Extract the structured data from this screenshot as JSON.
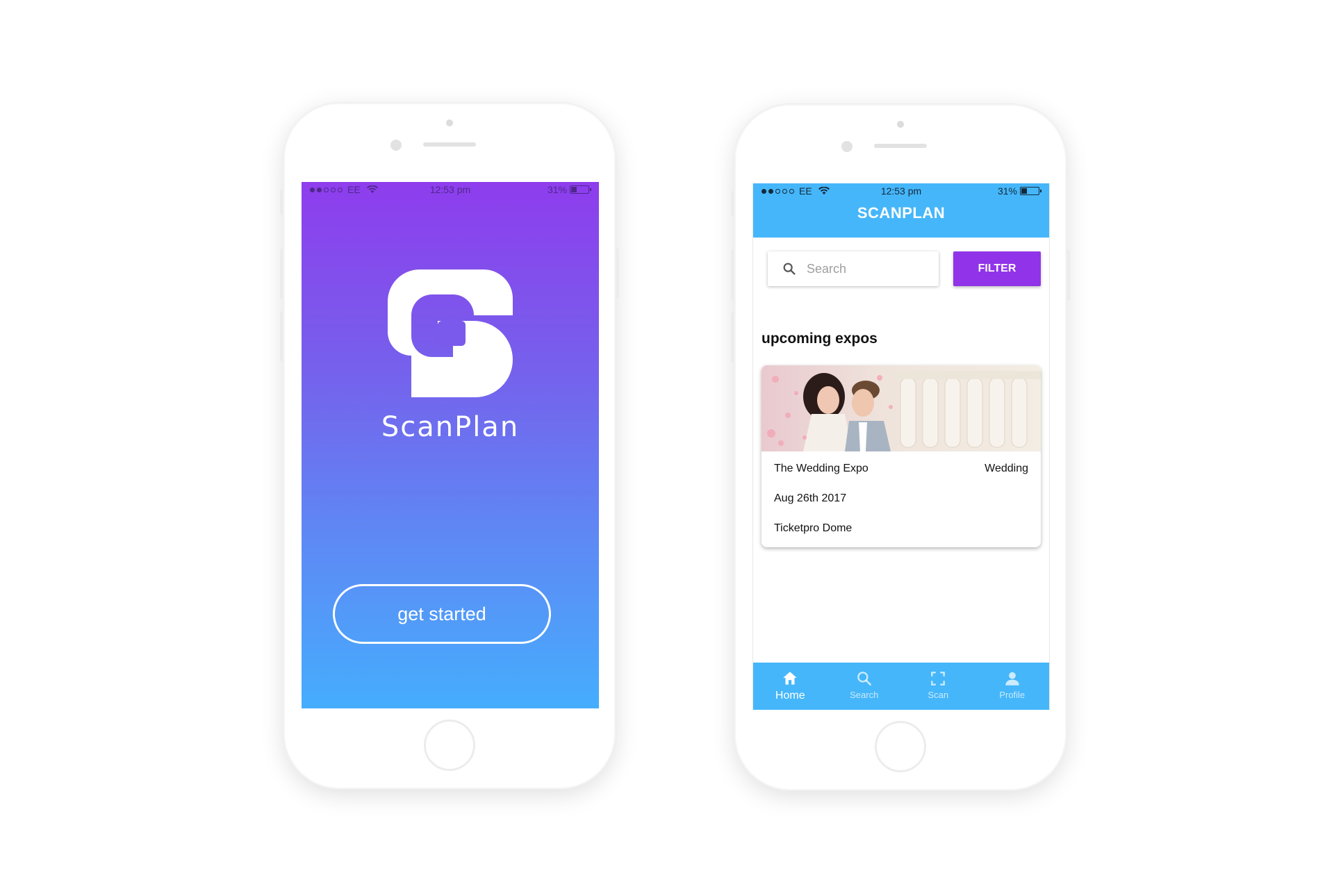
{
  "status_bar": {
    "carrier": "EE",
    "time": "12:53 pm",
    "battery": "31%",
    "signal_bars": 5,
    "signal_filled": 2
  },
  "splash": {
    "app_name": "ScanPlan",
    "cta_label": "get started",
    "logo_icon": "scanplan-logo",
    "gradient": [
      "#8e3ded",
      "#45adfd"
    ]
  },
  "home": {
    "app_bar_title": "SCANPLAN",
    "search": {
      "placeholder": "Search",
      "value": ""
    },
    "filter_label": "FILTER",
    "section_title": "upcoming expos",
    "expos": [
      {
        "title": "The Wedding Expo",
        "category": "Wedding",
        "date": "Aug 26th 2017",
        "venue": "Ticketpro Dome"
      }
    ],
    "bottom_nav": [
      {
        "label": "Home",
        "icon": "home-icon",
        "active": true
      },
      {
        "label": "Search",
        "icon": "search-icon",
        "active": false
      },
      {
        "label": "Scan",
        "icon": "scan-icon",
        "active": false
      },
      {
        "label": "Profile",
        "icon": "profile-icon",
        "active": false
      }
    ]
  },
  "colors": {
    "app_bar": "#45b6fa",
    "filter_button": "#9134e9",
    "splash_top": "#8e3ded",
    "splash_bottom": "#45adfd"
  }
}
